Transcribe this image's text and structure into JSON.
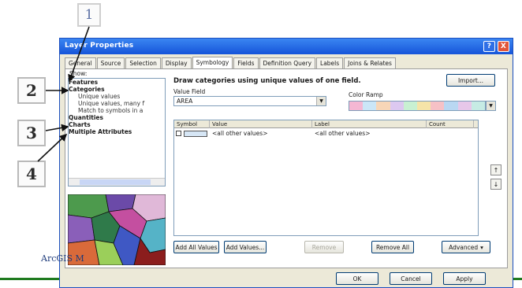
{
  "callouts": {
    "c1": "1",
    "c2": "2",
    "c3": "3",
    "c4": "4"
  },
  "window": {
    "title": "Layer Properties",
    "help_glyph": "?",
    "close_glyph": "X"
  },
  "tabs": [
    {
      "label": "General"
    },
    {
      "label": "Source"
    },
    {
      "label": "Selection"
    },
    {
      "label": "Display"
    },
    {
      "label": "Symbology"
    },
    {
      "label": "Fields"
    },
    {
      "label": "Definition Query"
    },
    {
      "label": "Labels"
    },
    {
      "label": "Joins & Relates"
    }
  ],
  "show": {
    "label": "Show:",
    "items": [
      "Features",
      "Categories",
      "Unique values",
      "Unique values, many f",
      "Match to symbols in a",
      "Quantities",
      "Charts",
      "Multiple Attributes"
    ]
  },
  "main": {
    "heading": "Draw categories using unique values of one field.",
    "import_label": "Import...",
    "value_field_label": "Value Field",
    "value_field_value": "AREA",
    "color_ramp_label": "Color Ramp"
  },
  "grid": {
    "headers": [
      "Symbol",
      "Value",
      "Label",
      "Count"
    ],
    "rows": [
      {
        "value": "<all other values>",
        "label": "<all other values>",
        "count": ""
      }
    ]
  },
  "buttons": {
    "add_all": "Add All Values",
    "add": "Add Values...",
    "remove": "Remove",
    "remove_all": "Remove All",
    "advanced": "Advanced",
    "ok": "OK",
    "cancel": "Cancel",
    "apply": "Apply"
  },
  "icons": {
    "move_up": "up-arrow-icon",
    "move_down": "down-arrow-icon",
    "dropdown": "chevron-down-icon"
  },
  "colors": {
    "accent": "#1554d9",
    "ramp": [
      "#f4b7d3",
      "#cbe6f7",
      "#f8d6b7",
      "#dcc8f0",
      "#c8f0d2",
      "#f5e4a8",
      "#f6c1c6",
      "#b9d7f2",
      "#e7c7e9",
      "#c6ebe4"
    ]
  },
  "footer": {
    "arcgis": "ArcGIS M"
  }
}
